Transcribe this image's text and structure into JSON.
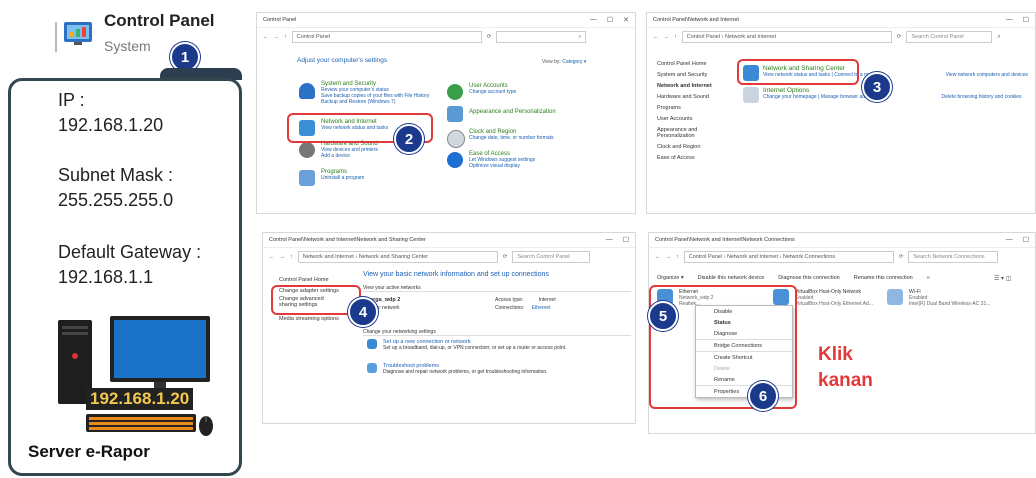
{
  "control_panel_header": {
    "title": "Control Panel",
    "subtitle": "System",
    "step": "1"
  },
  "info": {
    "ip_label": "IP :",
    "ip_value": "192.168.1.20",
    "subnet_label": "Subnet Mask :",
    "subnet_value": "255.255.255.0",
    "gateway_label": "Default Gateway :",
    "gateway_value": "192.168.1.1",
    "monitor_ip": "192.168.1.20",
    "server_label": "Server e-Rapor"
  },
  "win1": {
    "title": "Control Panel",
    "address": "Control Panel",
    "heading": "Adjust your computer's settings",
    "view_by": "View by:",
    "view_by_value": "Category ▾",
    "items_left": [
      {
        "title": "System and Security",
        "links": [
          "Review your computer's status",
          "Save backup copies of your files with File History",
          "Backup and Restore (Windows 7)"
        ]
      },
      {
        "title": "Network and Internet",
        "links": [
          "View network status and tasks"
        ]
      },
      {
        "title": "Hardware and Sound",
        "links": [
          "View devices and printers",
          "Add a device"
        ]
      },
      {
        "title": "Programs",
        "links": [
          "Uninstall a program"
        ]
      }
    ],
    "items_right": [
      {
        "title": "User Accounts",
        "links": [
          "Change account type"
        ]
      },
      {
        "title": "Appearance and Personalization",
        "links": []
      },
      {
        "title": "Clock and Region",
        "links": [
          "Change date, time, or number formats"
        ]
      },
      {
        "title": "Ease of Access",
        "links": [
          "Let Windows suggest settings",
          "Optimize visual display"
        ]
      }
    ],
    "step": "2"
  },
  "win2": {
    "title": "Control Panel\\Network and Internet",
    "address": "Control Panel  ›  Network and Internet",
    "search": "Search Control Panel",
    "nav": [
      "Control Panel Home",
      "System and Security",
      "Network and Internet",
      "Hardware and Sound",
      "Programs",
      "User Accounts",
      "Appearance and Personalization",
      "Clock and Region",
      "Ease of Access"
    ],
    "nsc_title": "Network and Sharing Center",
    "nsc_links": [
      "View network status and tasks",
      "Connect to a network",
      "View network computers and devices"
    ],
    "io_title": "Internet Options",
    "io_links": [
      "Change your homepage",
      "Manage browser add-ons",
      "Delete browsing history and cookies"
    ],
    "step": "3"
  },
  "win3": {
    "title": "Control Panel\\Network and Internet\\Network and Sharing Center",
    "address": "Network and Internet  ›  Network and Sharing Center",
    "search": "Search Control Panel",
    "nav": [
      "Control Panel Home",
      "Change adapter settings",
      "Change advanced sharing settings",
      "Media streaming options"
    ],
    "heading": "View your basic network information and set up connections",
    "active": "View your active networks",
    "network_name": "sarga_wdp 2",
    "network_type": "Public network",
    "access_label": "Access type:",
    "access_value": "Internet",
    "conn_label": "Connections:",
    "conn_value": "Ethernet",
    "change_heading": "Change your networking settings",
    "setup_title": "Set up a new connection or network",
    "setup_desc": "Set up a broadband, dial-up, or VPN connection; or set up a router or access point.",
    "trouble_title": "Troubleshoot problems",
    "trouble_desc": "Diagnose and repair network problems, or get troubleshooting information.",
    "step": "4"
  },
  "win4": {
    "title": "Control Panel\\Network and Internet\\Network Connections",
    "address": "Control Panel  ›  Network and Internet  ›  Network Connections",
    "search": "Search Network Connections",
    "toolbar": [
      "Organize ▾",
      "Disable this network device",
      "Diagnose this connection",
      "Rename this connection",
      "»"
    ],
    "adapters": [
      {
        "name": "Ethernet",
        "status": "Network_wdp 2",
        "dev": "Realtek..."
      },
      {
        "name": "VirtualBox Host-Only Network",
        "status": "Enabled",
        "dev": "VirtualBox Host-Only Ethernet Ad..."
      },
      {
        "name": "Wi-Fi",
        "status": "Enabled",
        "dev": "Intel(R) Dual Band Wireless-AC 31..."
      }
    ],
    "menu": [
      "Disable",
      "Status",
      "Diagnose",
      "Bridge Connections",
      "Create Shortcut",
      "Delete",
      "Rename",
      "Properties"
    ],
    "annotation_line1": "Klik",
    "annotation_line2": "kanan",
    "step5": "5",
    "step6": "6"
  }
}
